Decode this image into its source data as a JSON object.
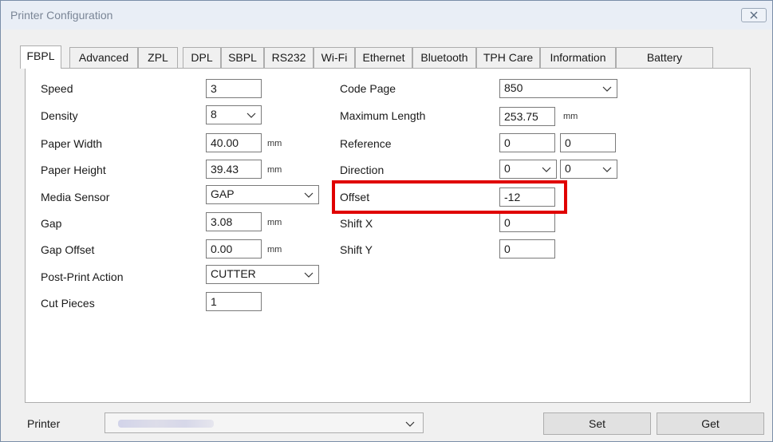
{
  "window": {
    "title": "Printer Configuration"
  },
  "tabs": [
    {
      "label": "FBPL",
      "active": true
    },
    {
      "label": "Advanced"
    },
    {
      "label": "ZPL"
    },
    {
      "label": "DPL"
    },
    {
      "label": "SBPL"
    },
    {
      "label": "RS232"
    },
    {
      "label": "Wi-Fi"
    },
    {
      "label": "Ethernet"
    },
    {
      "label": "Bluetooth"
    },
    {
      "label": "TPH Care"
    },
    {
      "label": "Information"
    },
    {
      "label": "Battery"
    }
  ],
  "left": {
    "speed": {
      "label": "Speed",
      "value": "3"
    },
    "density": {
      "label": "Density",
      "value": "8"
    },
    "paper_width": {
      "label": "Paper Width",
      "value": "40.00",
      "unit": "mm"
    },
    "paper_height": {
      "label": "Paper Height",
      "value": "39.43",
      "unit": "mm"
    },
    "media_sensor": {
      "label": "Media Sensor",
      "value": "GAP"
    },
    "gap": {
      "label": "Gap",
      "value": "3.08",
      "unit": "mm"
    },
    "gap_offset": {
      "label": "Gap Offset",
      "value": "0.00",
      "unit": "mm"
    },
    "post_print_action": {
      "label": "Post-Print Action",
      "value": "CUTTER"
    },
    "cut_pieces": {
      "label": "Cut Pieces",
      "value": "1"
    }
  },
  "right": {
    "code_page": {
      "label": "Code Page",
      "value": "850"
    },
    "maximum_length": {
      "label": "Maximum Length",
      "value": "253.75",
      "unit": "mm"
    },
    "reference": {
      "label": "Reference",
      "x": "0",
      "y": "0"
    },
    "direction": {
      "label": "Direction",
      "a": "0",
      "b": "0"
    },
    "offset": {
      "label": "Offset",
      "value": "-12"
    },
    "shift_x": {
      "label": "Shift X",
      "value": "0"
    },
    "shift_y": {
      "label": "Shift Y",
      "value": "0"
    }
  },
  "footer": {
    "printer_label": "Printer",
    "set_label": "Set",
    "get_label": "Get"
  },
  "colors": {
    "highlight": "#e00000",
    "title_text": "#7a8596"
  }
}
